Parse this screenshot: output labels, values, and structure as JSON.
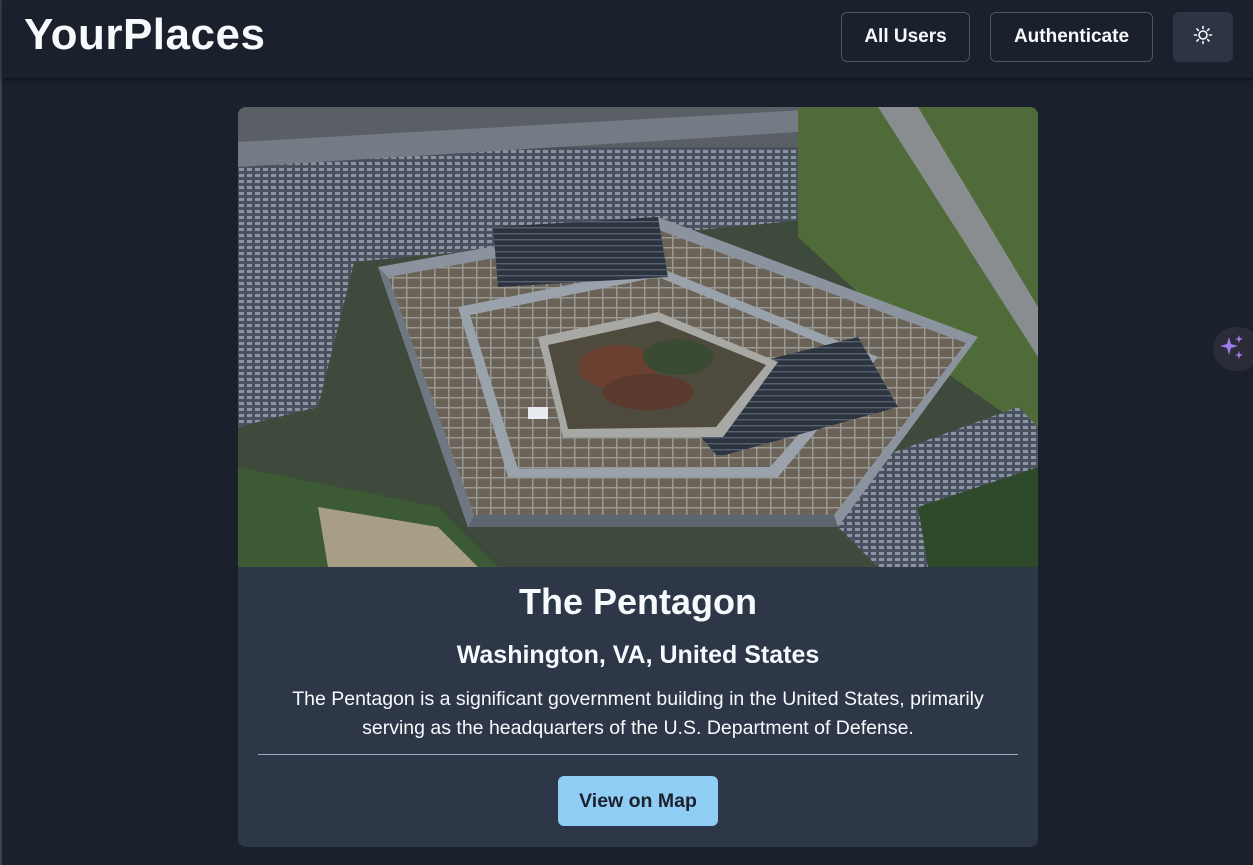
{
  "header": {
    "brand": "YourPlaces",
    "nav": {
      "all_users": "All Users",
      "authenticate": "Authenticate"
    },
    "theme_toggle_icon": "sun-icon"
  },
  "place": {
    "image_alt": "The Pentagon",
    "title": "The Pentagon",
    "address": "Washington, VA, United States",
    "description": "The Pentagon is a significant government building in the United States, primarily serving as the headquarters of the U.S. Department of Defense.",
    "view_on_map_label": "View on Map"
  },
  "assistant_icon": "sparkles-icon",
  "colors": {
    "background": "#1a202c",
    "card": "#2d3748",
    "accent_button": "#90cdf4",
    "assistant_icon": "#9f7aea"
  }
}
